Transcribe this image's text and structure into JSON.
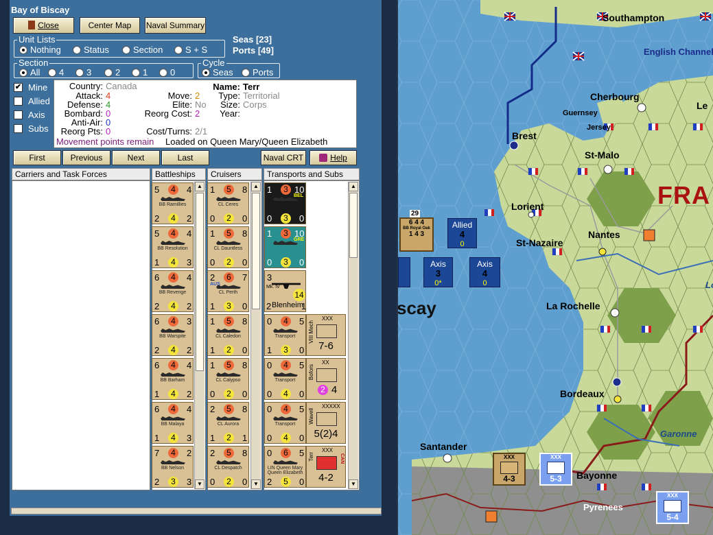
{
  "window": {
    "title": "Bay of Biscay"
  },
  "toolbar": {
    "close": "Close",
    "center_map": "Center Map",
    "naval_summary": "Naval Summary"
  },
  "summary": {
    "seas": "Seas [23]",
    "ports": "Ports [49]"
  },
  "unit_lists": {
    "legend": "Unit Lists",
    "options": [
      "Nothing",
      "Status",
      "Section",
      "S + S"
    ],
    "selected": "Nothing"
  },
  "section": {
    "legend": "Section",
    "options": [
      "All",
      "4",
      "3",
      "2",
      "1",
      "0"
    ],
    "selected": "All"
  },
  "cycle": {
    "legend": "Cycle",
    "options": [
      "Seas",
      "Ports"
    ],
    "selected": "Seas"
  },
  "filters": [
    {
      "label": "Mine",
      "checked": true
    },
    {
      "label": "Allied",
      "checked": false
    },
    {
      "label": "Axis",
      "checked": false
    },
    {
      "label": "Subs",
      "checked": false
    }
  ],
  "info": {
    "country_label": "Country:",
    "country": "Canada",
    "attack_label": "Attack:",
    "attack": "4",
    "defense_label": "Defense:",
    "defense": "4",
    "bombard_label": "Bombard:",
    "bombard": "0",
    "anti_air_label": "Anti-Air:",
    "anti_air": "0",
    "reorg_pts_label": "Reorg Pts:",
    "reorg_pts": "0",
    "move_label": "Move:",
    "move": "2",
    "elite_label": "Elite:",
    "elite": "No",
    "reorg_cost_label": "Reorg Cost:",
    "reorg_cost": "2",
    "cost_turns_label": "Cost/Turns:",
    "cost_turns": "2/1",
    "name_label": "Name:",
    "name": "Terr",
    "type_label": "Type:",
    "type": "Territorial",
    "size_label": "Size:",
    "size": "Corps",
    "year_label": "Year:",
    "movement_note": "Movement points remain",
    "loaded_note": "Loaded on Queen Mary/Queen Elizabeth",
    "colors": {
      "attack": "#e23a1f",
      "defense": "#2a9a2a",
      "bombard": "#c020c0",
      "antiair": "#2233cc",
      "move": "#d08a00",
      "status": "#7a1a7a"
    }
  },
  "nav": {
    "first": "First",
    "previous": "Previous",
    "next": "Next",
    "last": "Last",
    "naval_crt": "Naval CRT",
    "help": "Help"
  },
  "columns": {
    "carriers": "Carriers and Task Forces",
    "battleships": "Battleships",
    "cruisers": "Cruisers",
    "transports": "Transports and Subs"
  },
  "battleships": [
    {
      "tl": "5",
      "tm": "4",
      "tr": "4",
      "name": "BB Ramillies",
      "bl": "2",
      "bm": "4",
      "br": "2"
    },
    {
      "tl": "5",
      "tm": "4",
      "tr": "4",
      "name": "BB Resolution",
      "bl": "1",
      "bm": "4",
      "br": "3"
    },
    {
      "tl": "6",
      "tm": "4",
      "tr": "4",
      "name": "BB Revenge",
      "bl": "2",
      "bm": "4",
      "br": "2"
    },
    {
      "tl": "6",
      "tm": "4",
      "tr": "3",
      "name": "BB Warspite",
      "bl": "2",
      "bm": "4",
      "br": "2"
    },
    {
      "tl": "6",
      "tm": "4",
      "tr": "4",
      "name": "BB Barham",
      "bl": "1",
      "bm": "4",
      "br": "2"
    },
    {
      "tl": "6",
      "tm": "4",
      "tr": "4",
      "name": "BB Malaya",
      "bl": "1",
      "bm": "4",
      "br": "3"
    },
    {
      "tl": "7",
      "tm": "4",
      "tr": "2",
      "name": "BB Nelson",
      "bl": "2",
      "bm": "3",
      "br": "3"
    }
  ],
  "cruisers": [
    {
      "tl": "1",
      "tm": "5",
      "tr": "8",
      "name": "CL Ceres",
      "bl": "0",
      "bm": "2",
      "br": "0"
    },
    {
      "tl": "1",
      "tm": "5",
      "tr": "8",
      "name": "CL Dauntless",
      "bl": "0",
      "bm": "2",
      "br": "0"
    },
    {
      "tl": "2",
      "tm": "6",
      "tr": "7",
      "name": "CL Perth",
      "bl": "1",
      "bm": "3",
      "br": "0",
      "tag": "AUS"
    },
    {
      "tl": "1",
      "tm": "5",
      "tr": "8",
      "name": "CL Caledon",
      "bl": "1",
      "bm": "2",
      "br": "0"
    },
    {
      "tl": "1",
      "tm": "5",
      "tr": "8",
      "name": "CL Calypso",
      "bl": "0",
      "bm": "2",
      "br": "0"
    },
    {
      "tl": "2",
      "tm": "5",
      "tr": "8",
      "name": "CL Aurora",
      "bl": "1",
      "bm": "2",
      "br": "1"
    },
    {
      "tl": "2",
      "tm": "5",
      "tr": "8",
      "name": "CL Despatch",
      "bl": "0",
      "bm": "2",
      "br": "0"
    }
  ],
  "transports": [
    {
      "tl": "1",
      "tm": "3",
      "tr": "10",
      "name": "",
      "bl": "0",
      "bm": "3",
      "br": "0",
      "tag": "BEL",
      "style": "dark"
    },
    {
      "tl": "1",
      "tm": "3",
      "tr": "10",
      "name": "",
      "bl": "0",
      "bm": "3",
      "br": "0",
      "tag": "GRE",
      "style": "teal"
    },
    {
      "tl": "3",
      "tm": "",
      "tr": "",
      "name": "Blenheim",
      "bl": "2",
      "bm": "14",
      "br": "1",
      "tag": "Mk. IV",
      "style": "air"
    },
    {
      "tl": "0",
      "tm": "4",
      "tr": "5",
      "name": "Transport",
      "bl": "1",
      "bm": "3",
      "br": "0"
    },
    {
      "tl": "0",
      "tm": "4",
      "tr": "5",
      "name": "Transport",
      "bl": "0",
      "bm": "4",
      "br": "0"
    },
    {
      "tl": "0",
      "tm": "4",
      "tr": "5",
      "name": "Transport",
      "bl": "0",
      "bm": "4",
      "br": "0"
    },
    {
      "tl": "0",
      "tm": "6",
      "tr": "5",
      "name": "LIN Queen Mary Queen Elizabeth",
      "bl": "2",
      "bm": "5",
      "br": "0"
    }
  ],
  "land_units": [
    {
      "size": "XXX",
      "side": "VIII Mech",
      "big": "7-6"
    },
    {
      "size": "XX",
      "side": "Bofors",
      "big": "4",
      "pink": "2"
    },
    {
      "size": "XXXXX",
      "side": "Wavell",
      "big": "5(2)4"
    },
    {
      "size": "XXX",
      "side": "Terr",
      "big": "4-2",
      "tag": "CAN",
      "red": true
    }
  ],
  "map": {
    "labels": [
      "Southampton",
      "English Channel",
      "Cherbourg",
      "Guernsey",
      "Jersey",
      "Brest",
      "St-Malo",
      "Le",
      "FRA",
      "Lorient",
      "Nantes",
      "St-Nazaire",
      "scay",
      "La Rochelle",
      "Bordeaux",
      "Garonne",
      "Santander",
      "Bayonne",
      "Pyrenees",
      "Lo"
    ],
    "stacks": [
      {
        "side": "Allied",
        "value": "4",
        "sub": "0"
      },
      {
        "side": "Axis",
        "value": "3",
        "sub": "0*"
      },
      {
        "side": "Axis",
        "value": "4",
        "sub": "0"
      }
    ],
    "counters": [
      {
        "top": "29",
        "values": "6 4 4",
        "name": "BB Royal Oak",
        "bottom": "1 4 3"
      },
      {
        "size": "XXX",
        "value": "4-3"
      },
      {
        "size": "XXX",
        "value": "5-3",
        "blue": true
      },
      {
        "size": "XXX",
        "value": "5-4",
        "blue": true
      }
    ]
  }
}
